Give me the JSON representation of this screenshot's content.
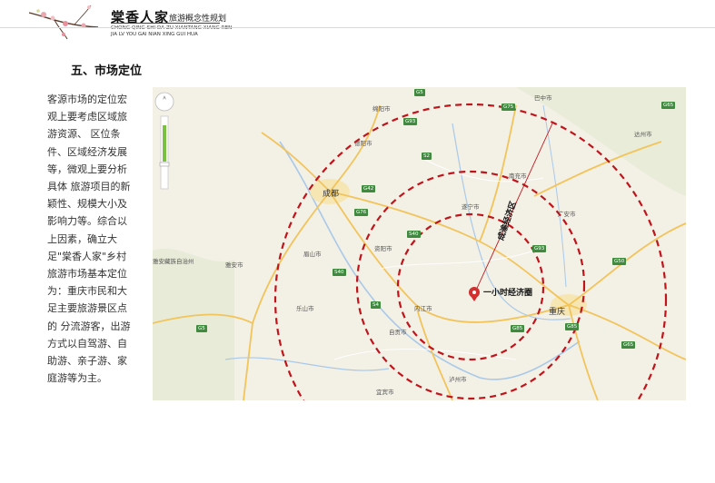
{
  "header": {
    "logo_text": "棠香人家",
    "plan_title": "旅游概念性规划",
    "pinyin_line1": "CHONG QING SHI DA ZU XIANTANG XIANG REN",
    "pinyin_line2": "JIA LV YOU GAI NIAN XING GUI HUA"
  },
  "section_title": "五、市场定位",
  "body_text": "客源市场的定位宏观上要考虑区域旅游资源、 区位条件、区域经济发展等，微观上要分析具体 旅游项目的新颖性、规模大小及影响力等。综合以上因素，确立大足\"棠香人家\"乡村旅游市场基本定位为：重庆市民和大足主要旅游景区点的 分流游客，出游方式以自驾游、自助游、亲子游、家庭游等为主。",
  "map": {
    "annotations": {
      "one_hour_circle": "一小时经济圈",
      "chengyu_zone": "成渝经济区"
    },
    "cities": [
      "绵阳市",
      "德阳市",
      "成都",
      "遂宁市",
      "南充市",
      "广安市",
      "资阳市",
      "眉山市",
      "雅安市",
      "乐山市",
      "内江市",
      "自贡市",
      "泸州市",
      "宜宾市",
      "重庆",
      "达州市",
      "巴中市",
      "雅安藏族自治州"
    ],
    "highways": [
      "G5",
      "G93",
      "G75",
      "G42",
      "G76",
      "G85",
      "G50",
      "G65",
      "S2",
      "S40",
      "S4",
      "G93",
      "G85",
      "G65",
      "S40",
      "G5"
    ]
  },
  "colors": {
    "circle_line": "#c0141a",
    "pin": "#d32f2f",
    "road_green": "#3e8b3e",
    "map_bg": "#f3f0e6"
  }
}
